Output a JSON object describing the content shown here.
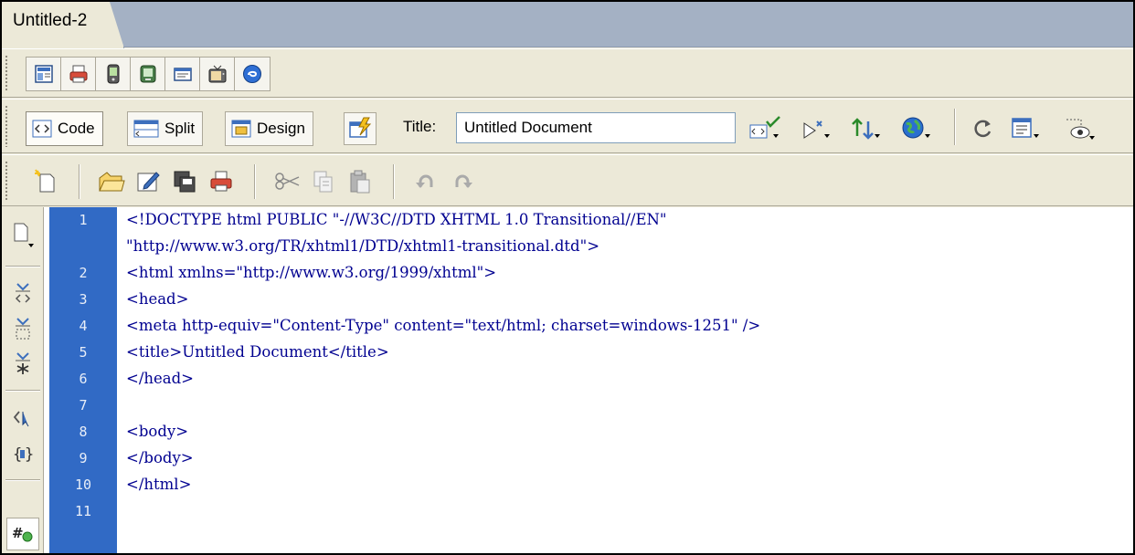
{
  "document_tab": {
    "label": "Untitled-2"
  },
  "document_toolbar": {
    "view_buttons": [
      {
        "name": "code-view-button",
        "label": "Code"
      },
      {
        "name": "split-view-button",
        "label": "Split"
      },
      {
        "name": "design-view-button",
        "label": "Design"
      }
    ],
    "title_label": "Title:",
    "title_value": "Untitled Document"
  },
  "code_lines": [
    {
      "number": "1",
      "text": "<!DOCTYPE html PUBLIC \"-//W3C//DTD XHTML 1.0 Transitional//EN\""
    },
    {
      "number": "",
      "text": "\"http://www.w3.org/TR/xhtml1/DTD/xhtml1-transitional.dtd\">"
    },
    {
      "number": "2",
      "text": "<html xmlns=\"http://www.w3.org/1999/xhtml\">"
    },
    {
      "number": "3",
      "text": "<head>"
    },
    {
      "number": "4",
      "text": "<meta http-equiv=\"Content-Type\" content=\"text/html; charset=windows-1251\" />"
    },
    {
      "number": "5",
      "text": "<title>Untitled Document</title>"
    },
    {
      "number": "6",
      "text": "</head>"
    },
    {
      "number": "7",
      "text": ""
    },
    {
      "number": "8",
      "text": "<body>"
    },
    {
      "number": "9",
      "text": "</body>"
    },
    {
      "number": "10",
      "text": "</html>"
    },
    {
      "number": "11",
      "text": ""
    }
  ],
  "colors": {
    "gutter": "#316ac5",
    "code_text": "#000090",
    "tab_strip": "#a4b1c4",
    "chrome": "#ece9d8"
  }
}
